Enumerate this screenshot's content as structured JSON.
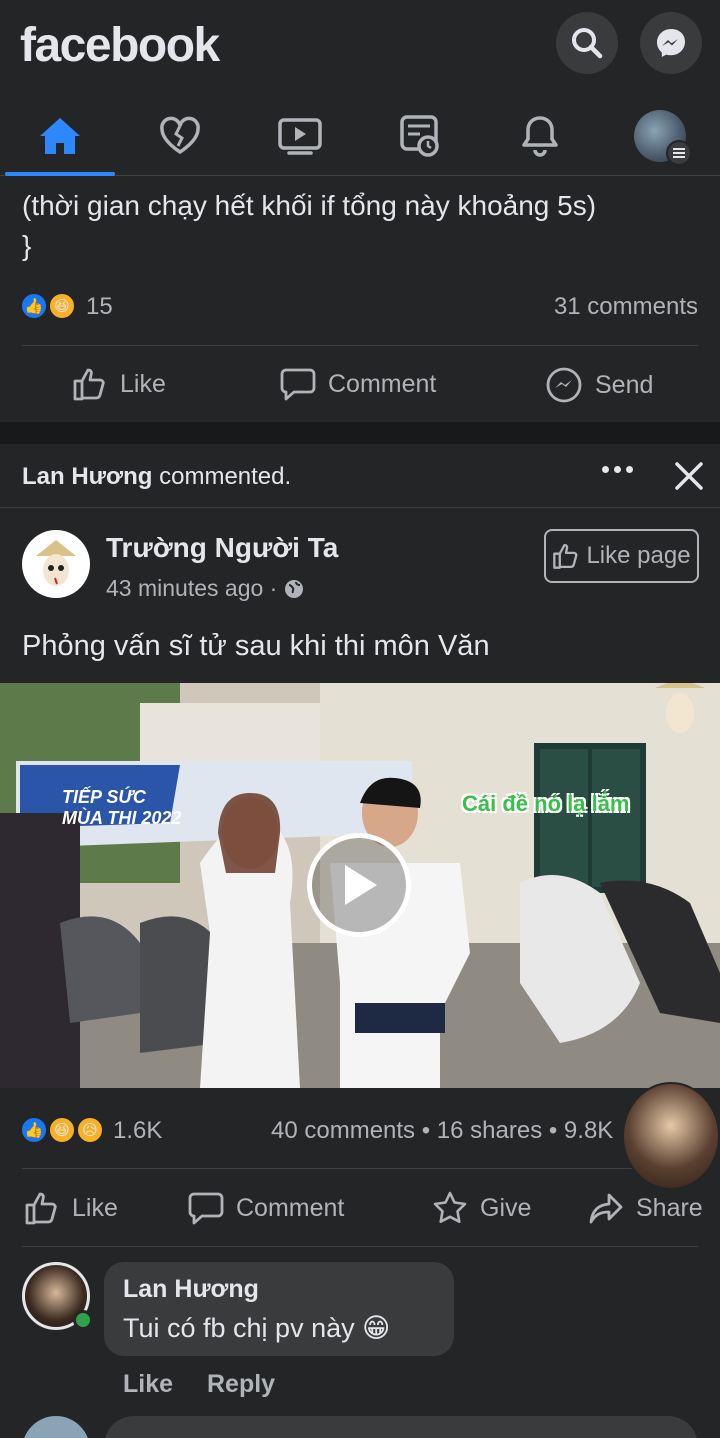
{
  "header": {
    "logo": "facebook",
    "search_icon": "search-icon",
    "messenger_icon": "messenger-icon"
  },
  "nav": {
    "items": [
      "home-icon",
      "heart-icon",
      "video-icon",
      "news-icon",
      "bell-icon",
      "profile-avatar"
    ],
    "active_color": "#2d88ff"
  },
  "post1": {
    "text_line1": "(thời gian chạy hết khối if tổng này khoảng 5s)",
    "text_line2": "}",
    "reaction_count": "15",
    "comments": "31 comments",
    "like_label": "Like",
    "comment_label": "Comment",
    "send_label": "Send"
  },
  "post2": {
    "activity_name": "Lan Hương",
    "activity_text": " commented.",
    "page_name": "Trường Người Ta",
    "time": "43 minutes ago ·",
    "like_page_label": "Like page",
    "caption": "Phỏng vấn sĩ tử sau khi thi môn Văn",
    "video_overlay_text": "Cái đề nó lạ lắm",
    "banner_text": "TIẾP SỨC MÙA THI 2022",
    "reaction_count": "1.6K",
    "stats": "40 comments • 16 shares • 9.8K",
    "like_label": "Like",
    "comment_label": "Comment",
    "give_label": "Give",
    "share_label": "Share"
  },
  "comment": {
    "author": "Lan Hương",
    "text": "Tui có fb chị pv này 😁",
    "like_label": "Like",
    "reply_label": "Reply"
  },
  "colors": {
    "background": "#242526",
    "separator": "#18191a",
    "accent": "#2d88ff",
    "online": "#31a24c",
    "like_blue": "#1877f2"
  }
}
